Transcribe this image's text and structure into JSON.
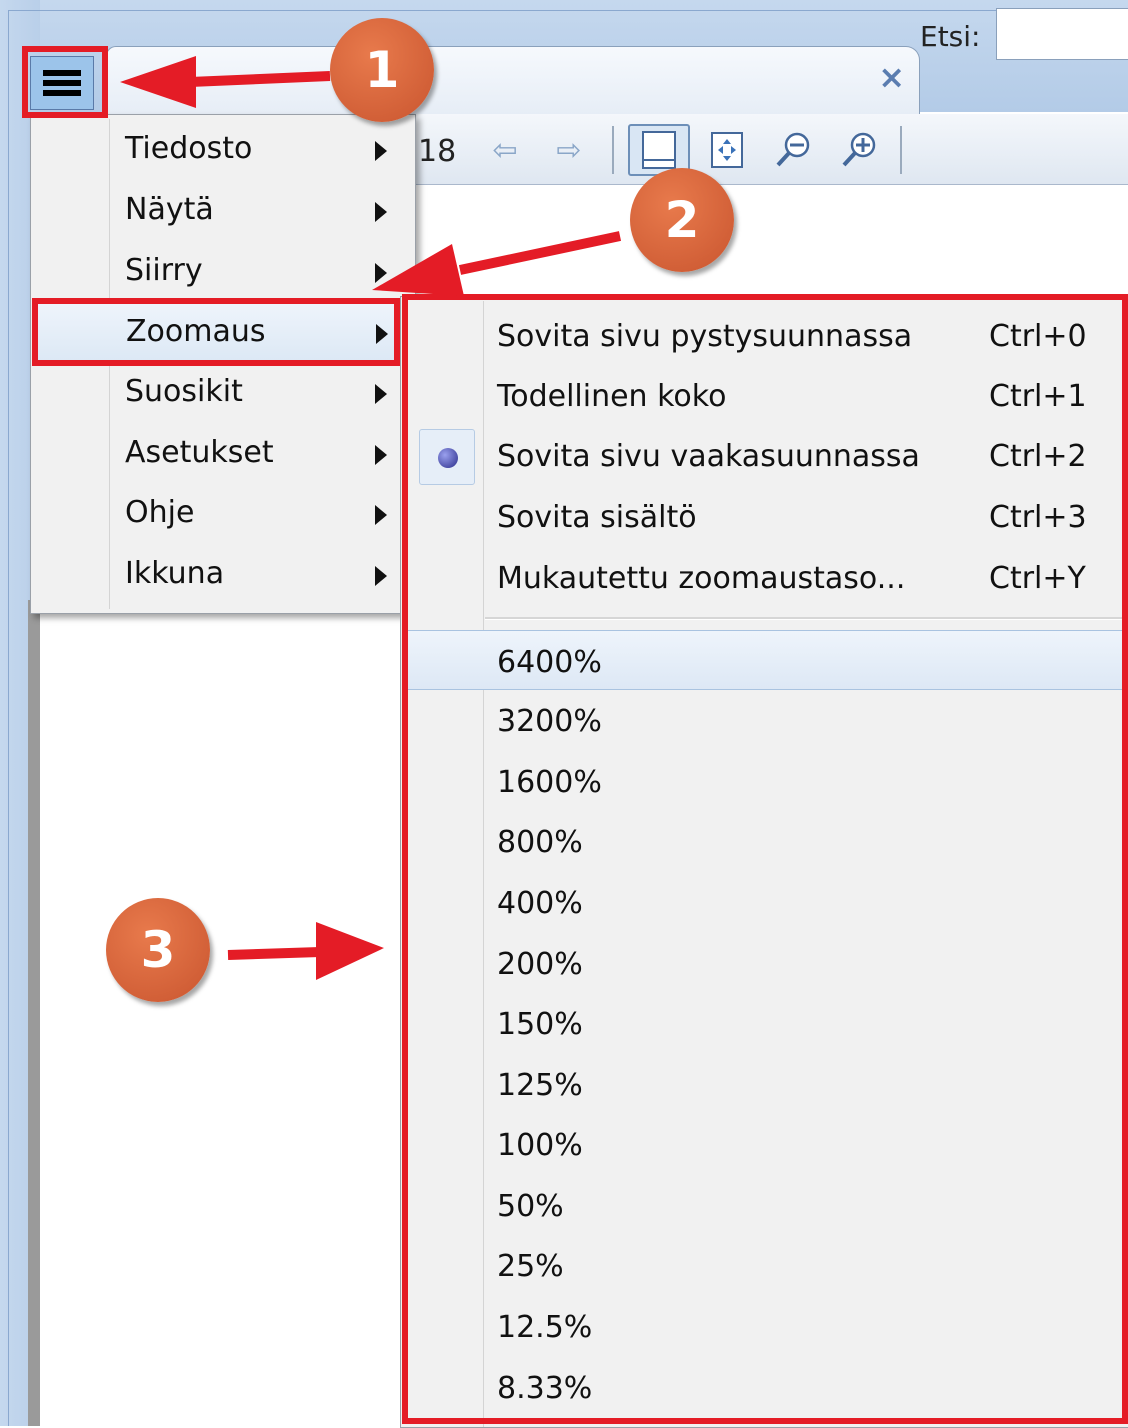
{
  "tab": {
    "close_glyph": "×"
  },
  "toolbar": {
    "page_fragment": "18",
    "search_label": "Etsi:"
  },
  "menu": {
    "items": [
      {
        "label": "Tiedosto"
      },
      {
        "label": "Näytä"
      },
      {
        "label": "Siirry"
      },
      {
        "label": "Zoomaus"
      },
      {
        "label": "Suosikit"
      },
      {
        "label": "Asetukset"
      },
      {
        "label": "Ohje"
      },
      {
        "label": "Ikkuna"
      }
    ]
  },
  "zoom_submenu": {
    "commands": [
      {
        "label": "Sovita sivu pystysuunnassa",
        "shortcut": "Ctrl+0"
      },
      {
        "label": "Todellinen koko",
        "shortcut": "Ctrl+1"
      },
      {
        "label": "Sovita sivu vaakasuunnassa",
        "shortcut": "Ctrl+2",
        "selected": true
      },
      {
        "label": "Sovita sisältö",
        "shortcut": "Ctrl+3"
      },
      {
        "label": "Mukautettu zoomaustaso...",
        "shortcut": "Ctrl+Y"
      }
    ],
    "levels": [
      "6400%",
      "3200%",
      "1600%",
      "800%",
      "400%",
      "200%",
      "150%",
      "125%",
      "100%",
      "50%",
      "25%",
      "12.5%",
      "8.33%"
    ]
  },
  "annotations": {
    "badges": [
      "1",
      "2",
      "3"
    ],
    "color": "#e41c26",
    "badge_color": "#d8613a"
  },
  "icons": [
    "menu-icon",
    "close-icon",
    "back-arrow-icon",
    "forward-arrow-icon",
    "fit-page-icon",
    "fit-width-icon",
    "zoom-out-icon",
    "zoom-in-icon",
    "submenu-arrow-icon",
    "radio-selected-icon"
  ]
}
